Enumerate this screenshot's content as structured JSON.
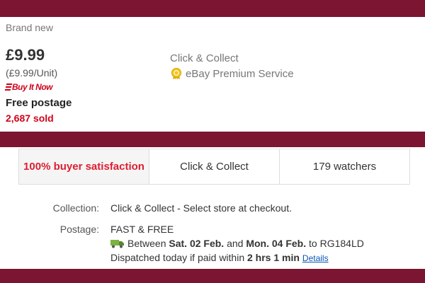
{
  "listing": {
    "condition": "Brand new",
    "price": "£9.99",
    "unit_price": "(£9.99/Unit)",
    "buy_it_now": "Buy It Now",
    "free_postage": "Free postage",
    "sold": "2,687 sold",
    "click_collect": "Click & Collect",
    "premium_service": "eBay Premium Service"
  },
  "summary": {
    "satisfaction": "100% buyer satisfaction",
    "click_collect": "Click & Collect",
    "watchers": "179 watchers"
  },
  "details": {
    "collection_label": "Collection:",
    "collection_value": "Click & Collect - Select store at checkout.",
    "postage_label": "Postage:",
    "postage_value": "FAST & FREE",
    "between": "Between",
    "date_from": "Sat. 02 Feb.",
    "and": "and",
    "date_to": "Mon. 04 Feb.",
    "to": "to RG184LD",
    "dispatched": "Dispatched today if paid within",
    "dispatch_time": "2 hrs 1 min",
    "details_link": "Details"
  },
  "colors": {
    "band": "#7b1532",
    "accent_red": "#d0021b",
    "link": "#0654ba"
  },
  "icons": {
    "premium": "premium-service-badge-icon",
    "delivery": "delivery-truck-icon"
  }
}
